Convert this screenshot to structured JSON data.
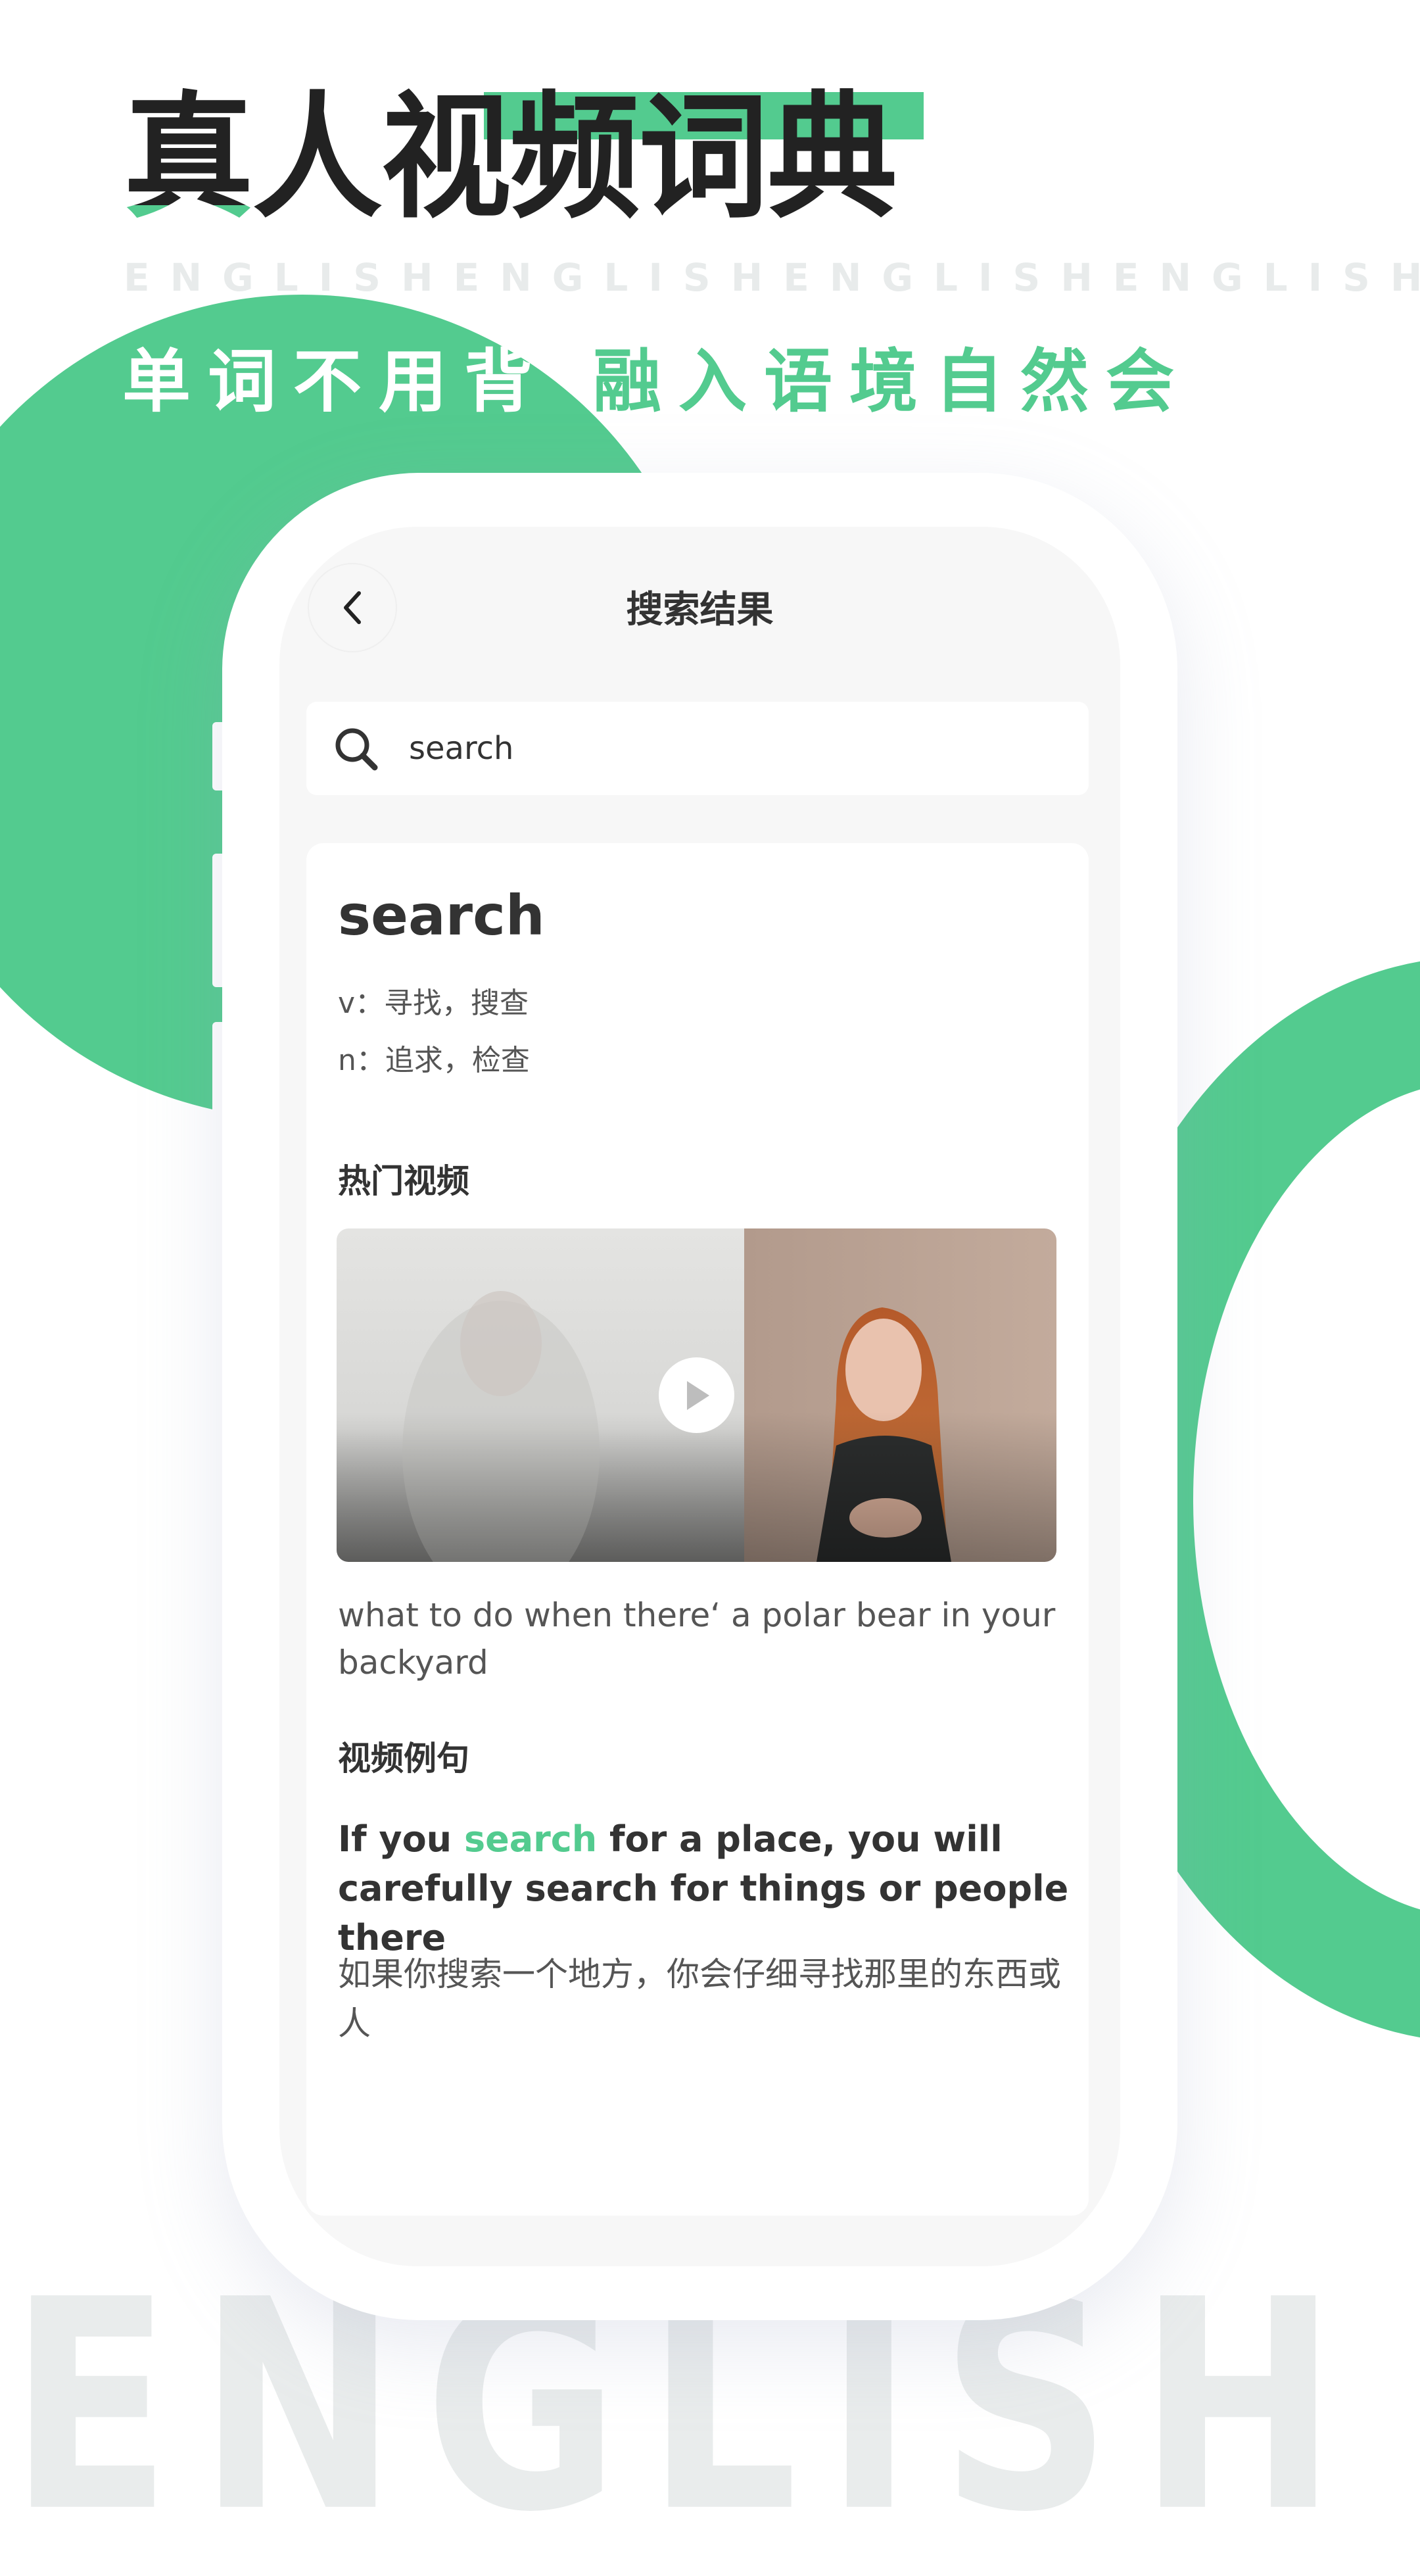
{
  "hero": {
    "title_first_char": "真",
    "title_rest": "人视频词典",
    "watermark_strip": "ENGLISHENGLISHENGLISHENGLISH",
    "slogan_left": "单词不用背",
    "slogan_right": "融入语境自然会",
    "big_watermark": "ENGLISH"
  },
  "colors": {
    "accent": "#53CB8F",
    "accent_light": "#86F2CC",
    "text_dark": "#333333",
    "text_muted": "#555555",
    "screen_bg": "#F7F7F7"
  },
  "screen": {
    "title": "搜索结果",
    "back_icon": "chevron-left-icon",
    "search": {
      "icon": "search-icon",
      "value": "search"
    },
    "result": {
      "word": "search",
      "definitions": [
        "v：寻找，搜查",
        "n：追求，检查"
      ],
      "hot_videos_heading": "热门视频",
      "video": {
        "play_icon": "play-icon",
        "caption": "what to do when there‘ a polar bear in your backyard"
      },
      "examples_heading": "视频例句",
      "example": {
        "en_before": "If you ",
        "en_highlight": "search",
        "en_after": " for a place, you will carefully search for things or people there",
        "zh": "如果你搜索一个地方，你会仔细寻找那里的东西或人"
      }
    }
  }
}
